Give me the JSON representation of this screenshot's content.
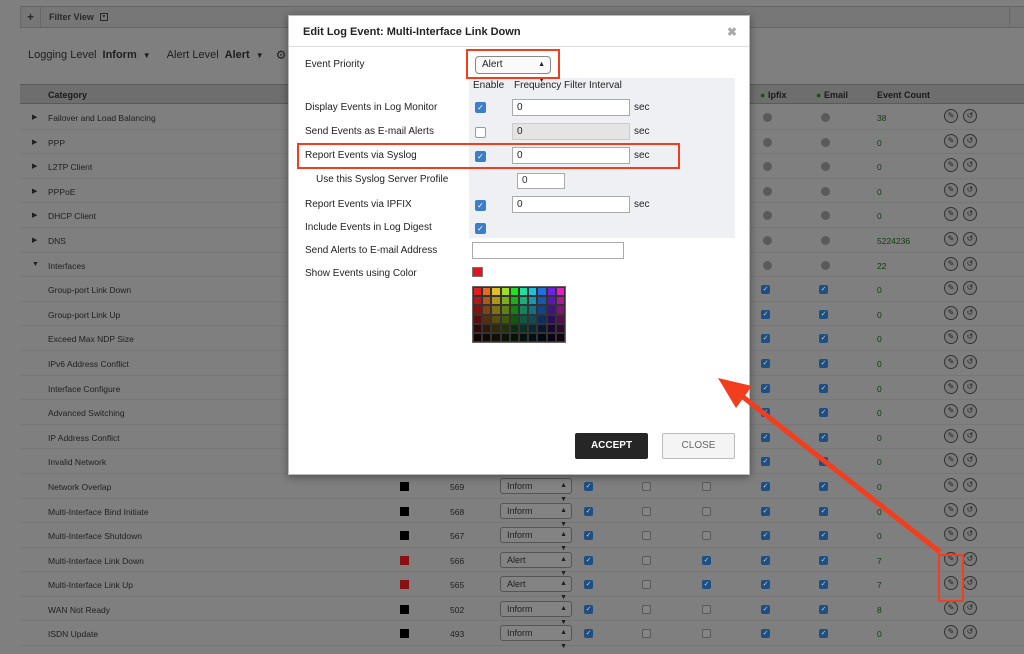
{
  "topbar": {
    "plus": "+",
    "filter_view": "Filter View"
  },
  "levels": {
    "logging_label": "Logging Level",
    "logging_value": "Inform",
    "alert_label": "Alert Level",
    "alert_value": "Alert"
  },
  "table": {
    "headers": {
      "category": "Category",
      "ipfix": "Ipfix",
      "email": "Email",
      "event_count": "Event Count"
    },
    "rows": [
      {
        "label": "Failover and Load Balancing",
        "count": "38",
        "type": "group"
      },
      {
        "label": "PPP",
        "count": "0",
        "type": "group"
      },
      {
        "label": "L2TP Client",
        "count": "0",
        "type": "group"
      },
      {
        "label": "PPPoE",
        "count": "0",
        "type": "group"
      },
      {
        "label": "DHCP Client",
        "count": "0",
        "type": "group"
      },
      {
        "label": "DNS",
        "count": "5224236",
        "type": "group"
      },
      {
        "label": "Interfaces",
        "count": "22",
        "type": "open"
      },
      {
        "label": "Group-port Link Down",
        "count": "0",
        "type": "sub"
      },
      {
        "label": "Group-port Link Up",
        "count": "0",
        "type": "sub"
      },
      {
        "label": "Exceed Max NDP Size",
        "count": "0",
        "type": "sub"
      },
      {
        "label": "IPv6 Address Conflict",
        "count": "0",
        "type": "sub"
      },
      {
        "label": "Interface Configure",
        "count": "0",
        "type": "sub"
      },
      {
        "label": "Advanced Switching",
        "count": "0",
        "type": "sub"
      },
      {
        "label": "IP Address Conflict",
        "count": "0",
        "type": "sub"
      },
      {
        "label": "Invalid Network",
        "count": "0",
        "type": "sub"
      },
      {
        "label": "Network Overlap",
        "count": "0",
        "type": "full",
        "id": "569",
        "priority": "Inform",
        "color": "#000000"
      },
      {
        "label": "Multi-Interface Bind Initiate",
        "count": "0",
        "type": "full",
        "id": "568",
        "priority": "Inform",
        "color": "#000000"
      },
      {
        "label": "Multi-Interface Shutdown",
        "count": "0",
        "type": "full",
        "id": "567",
        "priority": "Inform",
        "color": "#000000"
      },
      {
        "label": "Multi-Interface Link Down",
        "count": "7",
        "type": "full",
        "id": "566",
        "priority": "Alert",
        "color": "#8a1111"
      },
      {
        "label": "Multi-Interface Link Up",
        "count": "7",
        "type": "full",
        "id": "565",
        "priority": "Alert",
        "color": "#8a1111"
      },
      {
        "label": "WAN Not Ready",
        "count": "8",
        "type": "full",
        "id": "502",
        "priority": "Inform",
        "color": "#000000"
      },
      {
        "label": "ISDN Update",
        "count": "0",
        "type": "full",
        "id": "493",
        "priority": "Inform",
        "color": "#000000"
      }
    ]
  },
  "modal": {
    "title": "Edit Log Event: Multi-Interface Link Down",
    "close": "✖",
    "event_priority_label": "Event Priority",
    "event_priority_value": "Alert",
    "col_enable": "Enable",
    "col_freq": "Frequency Filter Interval",
    "display_label": "Display Events in Log Monitor",
    "display_value": "0",
    "email_label": "Send Events as E-mail Alerts",
    "email_value": "0",
    "syslog_label": "Report Events via Syslog",
    "syslog_value": "0",
    "syslog_profile_label": "Use this Syslog Server Profile",
    "syslog_profile_value": "0",
    "ipfix_label": "Report Events via IPFIX",
    "ipfix_value": "0",
    "digest_label": "Include Events in Log Digest",
    "alerts_email_label": "Send Alerts to E-mail Address",
    "alerts_email_value": "",
    "color_label": "Show Events using Color",
    "sec": "sec",
    "accept": "ACCEPT",
    "close_btn": "CLOSE",
    "selected_color": "#e0161d"
  }
}
